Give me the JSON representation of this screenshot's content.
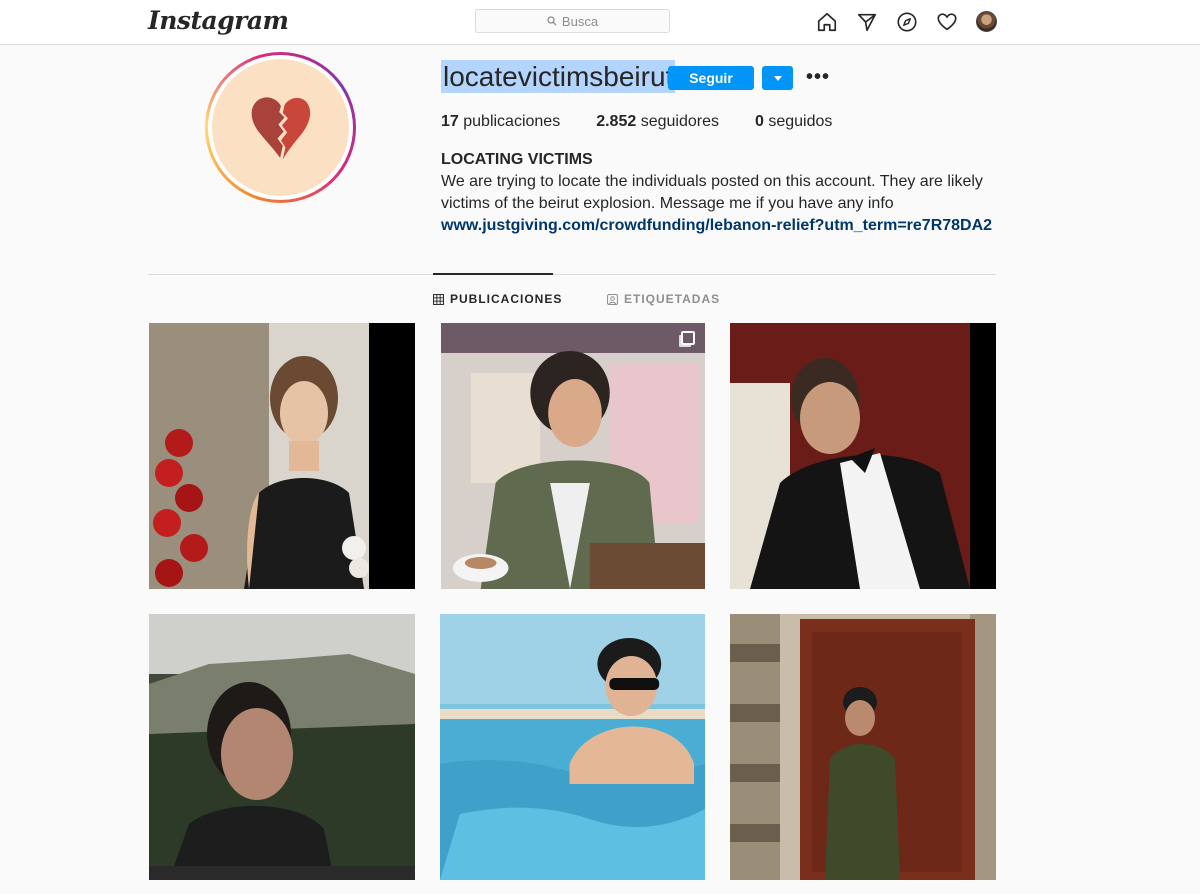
{
  "header": {
    "logo": "Instagram",
    "search_placeholder": "Busca",
    "nav_icons": [
      "home-icon",
      "direct-icon",
      "explore-icon",
      "activity-heart-icon",
      "profile-avatar"
    ]
  },
  "profile": {
    "username": "locatevictimsbeirut",
    "follow_label": "Seguir",
    "more_label": "•••",
    "stats": {
      "posts_count": "17",
      "posts_label": "publicaciones",
      "followers_count": "2.852",
      "followers_label": "seguidores",
      "following_count": "0",
      "following_label": "seguidos"
    },
    "bio": {
      "name": "LOCATING VICTIMS",
      "text": "We are trying to locate the individuals posted on this account. They are likely victims of the beirut explosion. Message me if you have any info",
      "link": "www.justgiving.com/crowdfunding/lebanon-relief?utm_term=re7R78DA2"
    }
  },
  "tabs": [
    {
      "label": "PUBLICACIONES",
      "active": true
    },
    {
      "label": "ETIQUETADAS",
      "active": false
    }
  ],
  "colors": {
    "accent": "#0095f6",
    "link": "#00376b",
    "avatar_bg": "#fce0c3",
    "heart_left": "#a8423a",
    "heart_right": "#c9463a"
  }
}
